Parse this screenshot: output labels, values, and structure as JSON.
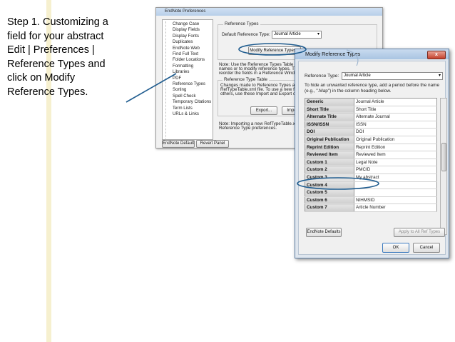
{
  "step": {
    "lines": [
      "Step 1. Customizing a",
      "field for your abstract",
      "Edit | Preferences |",
      "Reference Types and",
      "click on Modify",
      "Reference Types."
    ]
  },
  "prefs": {
    "title": "EndNote Preferences",
    "items": [
      "Change Case",
      "Display Fields",
      "Display Fonts",
      "Duplicates",
      "EndNote Web",
      "Find Full Text",
      "Folder Locations",
      "Formatting",
      "Libraries",
      "PDF",
      "Reference Types",
      "Sorting",
      "Spell Check",
      "Temporary Citations",
      "Term Lists",
      "URLs & Links"
    ],
    "group_title": "Reference Types",
    "default_type_label": "Default Reference Type:",
    "default_type_value": "Journal Article",
    "modify_button": "Modify Reference Types...",
    "note1": [
      "Note: Use the Reference Types Table to add, de",
      "names or to modify reference types. The table C",
      "reorder the fields in a Reference Window."
    ],
    "table_group_title": "Reference Type Table",
    "note2": [
      "Changes made to Reference Types are stored in",
      "RefTypeTable.xml file. To use a new file or to sh",
      "others, use these Import and Export options:"
    ],
    "export_button": "Export...",
    "import_button": "Impo",
    "note3": [
      "Note: Importing a new RefTypeTable.xml file wi",
      "Reference Type preferences."
    ],
    "endnote_defaults": "EndNote Defaults",
    "revert_panel": "Revert Panel"
  },
  "dialog": {
    "title": "Modify Reference Types",
    "close": "x",
    "ref_type_label": "Reference Type:",
    "ref_type_value": "Journal Article",
    "hint": [
      "To hide an unwanted reference type, add a period before the name",
      "(e.g., \".Map\") in the column heading below."
    ],
    "rows": [
      {
        "field": "Generic",
        "value": "Journal Article"
      },
      {
        "field": "Short Title",
        "value": "Short Title"
      },
      {
        "field": "Alternate Title",
        "value": "Alternate Journal"
      },
      {
        "field": "ISSN/ISSN",
        "value": "ISSN"
      },
      {
        "field": "DOI",
        "value": "DOI"
      },
      {
        "field": "Original Publication",
        "value": "Original Publication"
      },
      {
        "field": "Reprint Edition",
        "value": "Reprint Edition"
      },
      {
        "field": "Reviewed Item",
        "value": "Reviewed Item"
      },
      {
        "field": "Custom 1",
        "value": "Legal Note"
      },
      {
        "field": "Custom 2",
        "value": "PMCID"
      },
      {
        "field": "Custom 3",
        "value": "My abstract"
      },
      {
        "field": "Custom 4",
        "value": ""
      },
      {
        "field": "Custom 5",
        "value": ""
      },
      {
        "field": "Custom 6",
        "value": "NIHMSID"
      },
      {
        "field": "Custom 7",
        "value": "Article Number"
      }
    ],
    "endnote_defaults": "EndNote Defaults",
    "apply_all": "Apply to All Ref Types",
    "ok": "OK",
    "cancel": "Cancel"
  },
  "colors": {
    "stripe": "#f6f0cf",
    "annotation": "#1f5c8f"
  }
}
